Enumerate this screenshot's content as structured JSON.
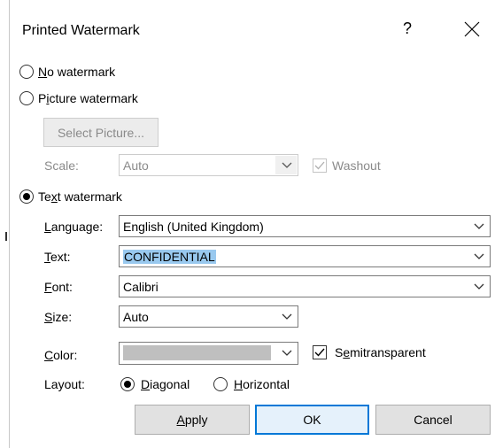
{
  "title": "Printed Watermark",
  "help_glyph": "?",
  "options": {
    "no_watermark": {
      "pre": "",
      "ul": "N",
      "post": "o watermark",
      "checked": false
    },
    "picture_watermark": {
      "pre": "P",
      "ul": "i",
      "post": "cture watermark",
      "checked": false
    },
    "text_watermark": {
      "pre": "Te",
      "ul": "x",
      "post": "t watermark",
      "checked": true
    }
  },
  "picture": {
    "select_button": "Select Picture...",
    "scale_label": "Scale:",
    "scale_value": "Auto",
    "washout_label": "Washout",
    "washout_checked": true
  },
  "text": {
    "language": {
      "ul": "L",
      "post": "anguage:",
      "value": "English (United Kingdom)"
    },
    "text": {
      "ul": "T",
      "post": "ext:",
      "value": "CONFIDENTIAL"
    },
    "font": {
      "ul": "F",
      "post": "ont:",
      "value": "Calibri"
    },
    "size": {
      "ul": "S",
      "post": "ize:",
      "value": "Auto"
    },
    "color": {
      "ul": "C",
      "post": "olor:",
      "swatch": "#bfbfbf"
    },
    "semitransparent": {
      "pre": "S",
      "ul": "e",
      "post": "mitransparent",
      "checked": true
    },
    "layout": {
      "label": "Layout:",
      "diagonal": {
        "ul": "D",
        "post": "iagonal",
        "checked": true
      },
      "horizontal": {
        "ul": "H",
        "post": "orizontal",
        "checked": false
      }
    }
  },
  "buttons": {
    "apply": {
      "ul": "A",
      "post": "pply"
    },
    "ok": "OK",
    "cancel": "Cancel"
  }
}
